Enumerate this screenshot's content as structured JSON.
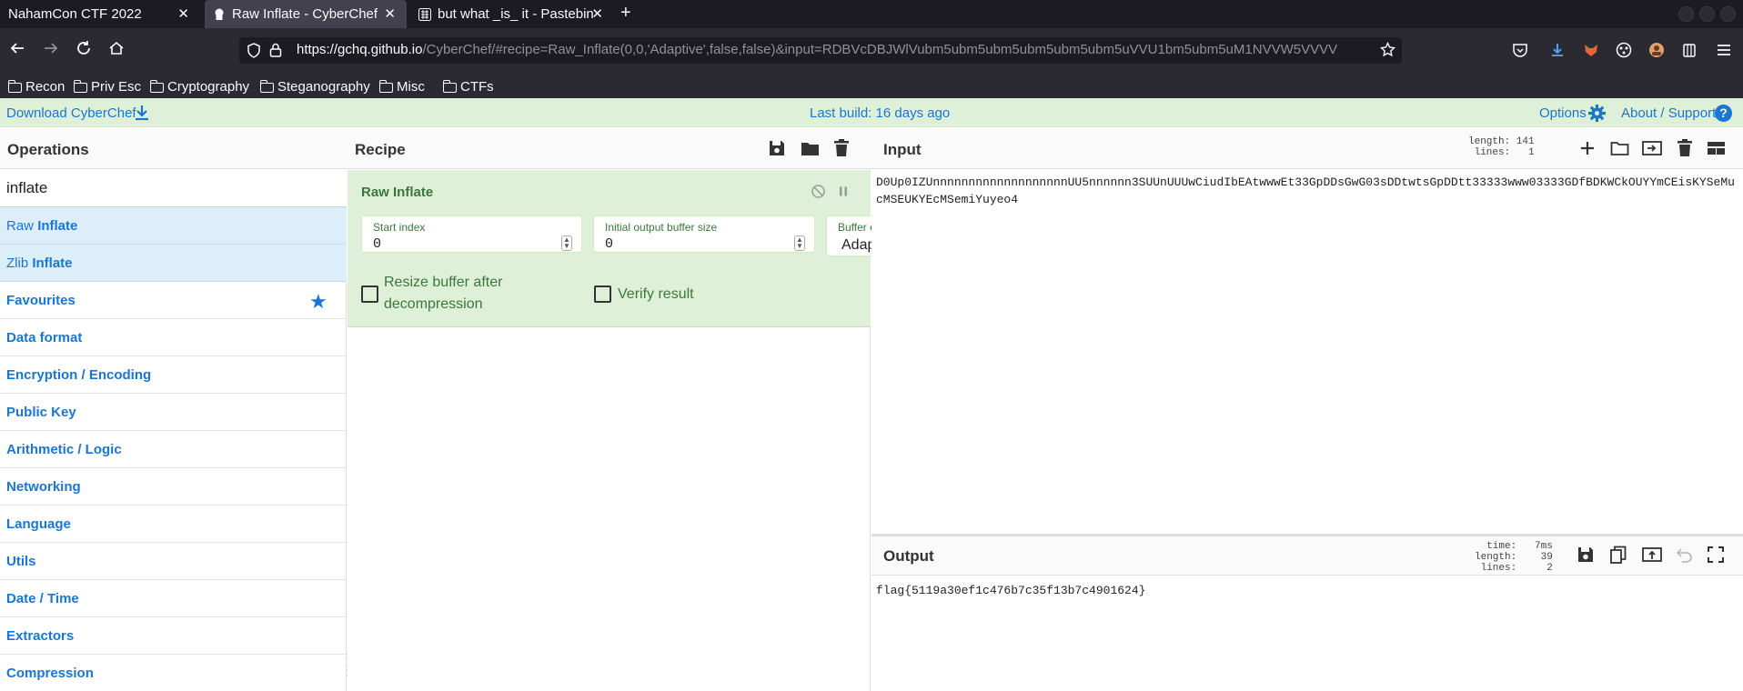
{
  "browser": {
    "tabs": [
      {
        "title": "NahamCon CTF 2022",
        "active": false
      },
      {
        "title": "Raw Inflate - CyberChef",
        "active": true
      },
      {
        "title": "but what _is_ it - Pastebin",
        "active": false
      }
    ],
    "close_glyph": "✕",
    "new_tab_glyph": "+",
    "url_host": "https://gchq.github.io",
    "url_rest": "/CyberChef/#recipe=Raw_Inflate(0,0,'Adaptive',false,false)&input=RDBVcDBJWlVubm5ubm5ubm5ubm5ubm5ubm5uVVU1bm5ubm5uM1NVVW5VVVV",
    "bookmarks": [
      "Recon",
      "Priv Esc",
      "Cryptography",
      "Steganography",
      "Misc",
      "CTFs"
    ]
  },
  "banner": {
    "download_label": "Download CyberChef",
    "last_build": "Last build: 16 days ago",
    "options_label": "Options",
    "about_label": "About / Support",
    "help_glyph": "?"
  },
  "operations": {
    "title": "Operations",
    "search_value": "inflate",
    "results": [
      {
        "prefix": "Raw ",
        "match": "Inflate"
      },
      {
        "prefix": "Zlib ",
        "match": "Inflate"
      }
    ],
    "categories": [
      "Favourites",
      "Data format",
      "Encryption / Encoding",
      "Public Key",
      "Arithmetic / Logic",
      "Networking",
      "Language",
      "Utils",
      "Date / Time",
      "Extractors",
      "Compression"
    ]
  },
  "recipe": {
    "title": "Recipe",
    "operation": {
      "name": "Raw Inflate",
      "start_index_label": "Start index",
      "start_index_value": "0",
      "initial_buffer_label": "Initial output buffer size",
      "initial_buffer_value": "0",
      "buffer_expansion_label": "Buffer expans...",
      "buffer_expansion_value": "Adaptive",
      "resize_label": "Resize buffer after decompression",
      "verify_label": "Verify result"
    }
  },
  "input": {
    "title": "Input",
    "stats": "length: 141\n lines:   1",
    "text": "D0Up0IZUnnnnnnnnnnnnnnnnnnnUU5nnnnnn3SUUnUUUwCiudIbEAtwwwEt33GpDDsGwG03sDDtwtsGpDDtt33333www03333GDfBDKWCkOUYYmCEisKYSeMucMSEUKYEcMSemiYuyeo4"
  },
  "output": {
    "title": "Output",
    "stats": "  time:   7ms\nlength:    39\n lines:     2",
    "text": "flag{5119a30ef1c476b7c35f13b7c4901624}"
  },
  "colors": {
    "accent": "#1976d2",
    "banner_bg": "#dff0d8",
    "recipe_green": "#3c763d",
    "result_bg": "#dbeef9"
  }
}
